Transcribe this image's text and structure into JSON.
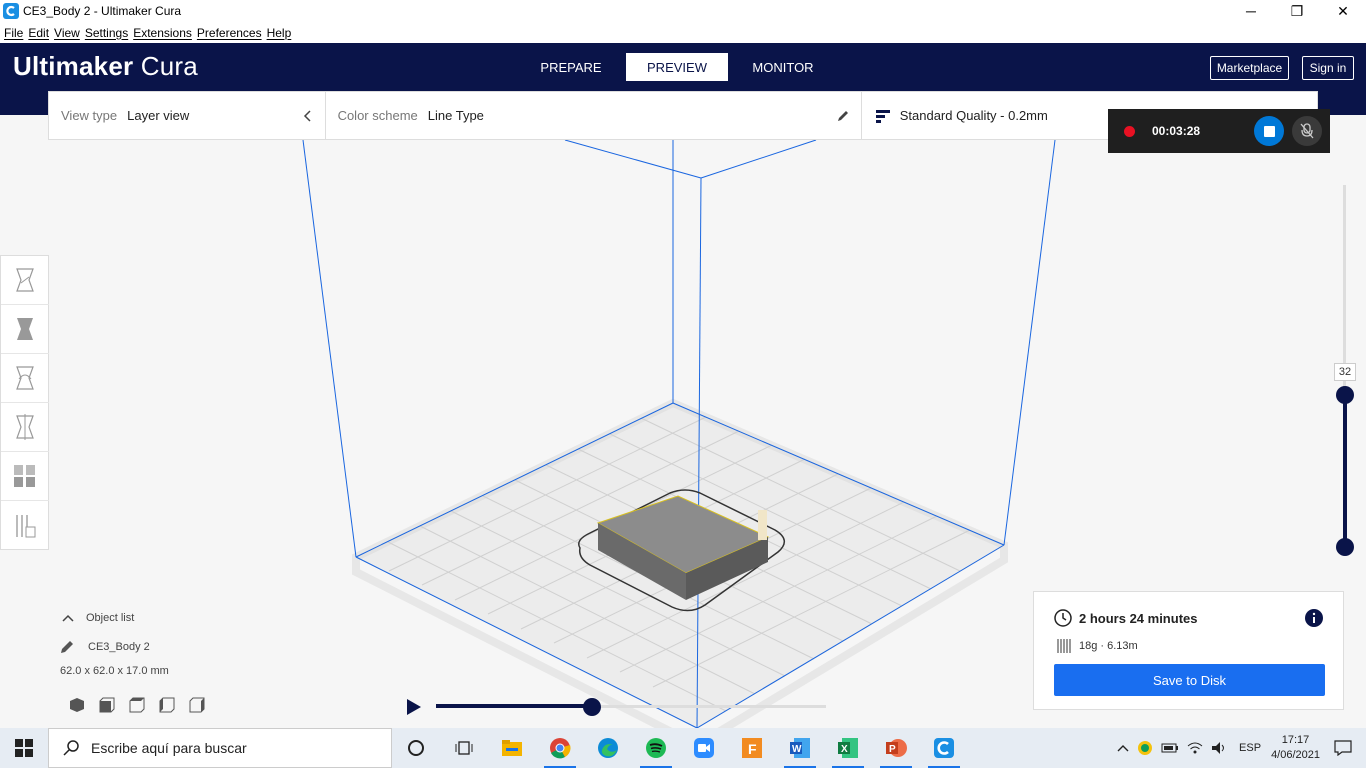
{
  "window": {
    "title": "CE3_Body 2 - Ultimaker Cura",
    "minimize": "─",
    "restore": "❐",
    "close": "✕"
  },
  "menu": [
    "File",
    "Edit",
    "View",
    "Settings",
    "Extensions",
    "Preferences",
    "Help"
  ],
  "header": {
    "logo_bold": "Ultimaker",
    "logo_light": "Cura",
    "tabs": [
      "PREPARE",
      "PREVIEW",
      "MONITOR"
    ],
    "active_tab": "PREVIEW",
    "marketplace": "Marketplace",
    "sign_in": "Sign in"
  },
  "viewbar": {
    "view_type_label": "View type",
    "view_type_value": "Layer view",
    "color_scheme_label": "Color scheme",
    "color_scheme_value": "Line Type",
    "quality": "Standard Quality - 0.2mm"
  },
  "recording": {
    "time": "00:03:28"
  },
  "object_list": {
    "header": "Object list",
    "object_name": "CE3_Body 2",
    "dimensions": "62.0 x 62.0 x 17.0 mm"
  },
  "layer_slider": {
    "current_layer": "32"
  },
  "playback": {
    "progress": 0.4
  },
  "print_info": {
    "time": "2 hours 24 minutes",
    "material": "18g · 6.13m",
    "save_button": "Save to Disk"
  },
  "taskbar": {
    "search_placeholder": "Escribe aquí para buscar",
    "language": "ESP",
    "time": "17:17",
    "date": "4/06/2021"
  },
  "colors": {
    "header_bg": "#0a1449",
    "accent_blue": "#196ef0",
    "build_volume_line": "#1a66e0"
  }
}
